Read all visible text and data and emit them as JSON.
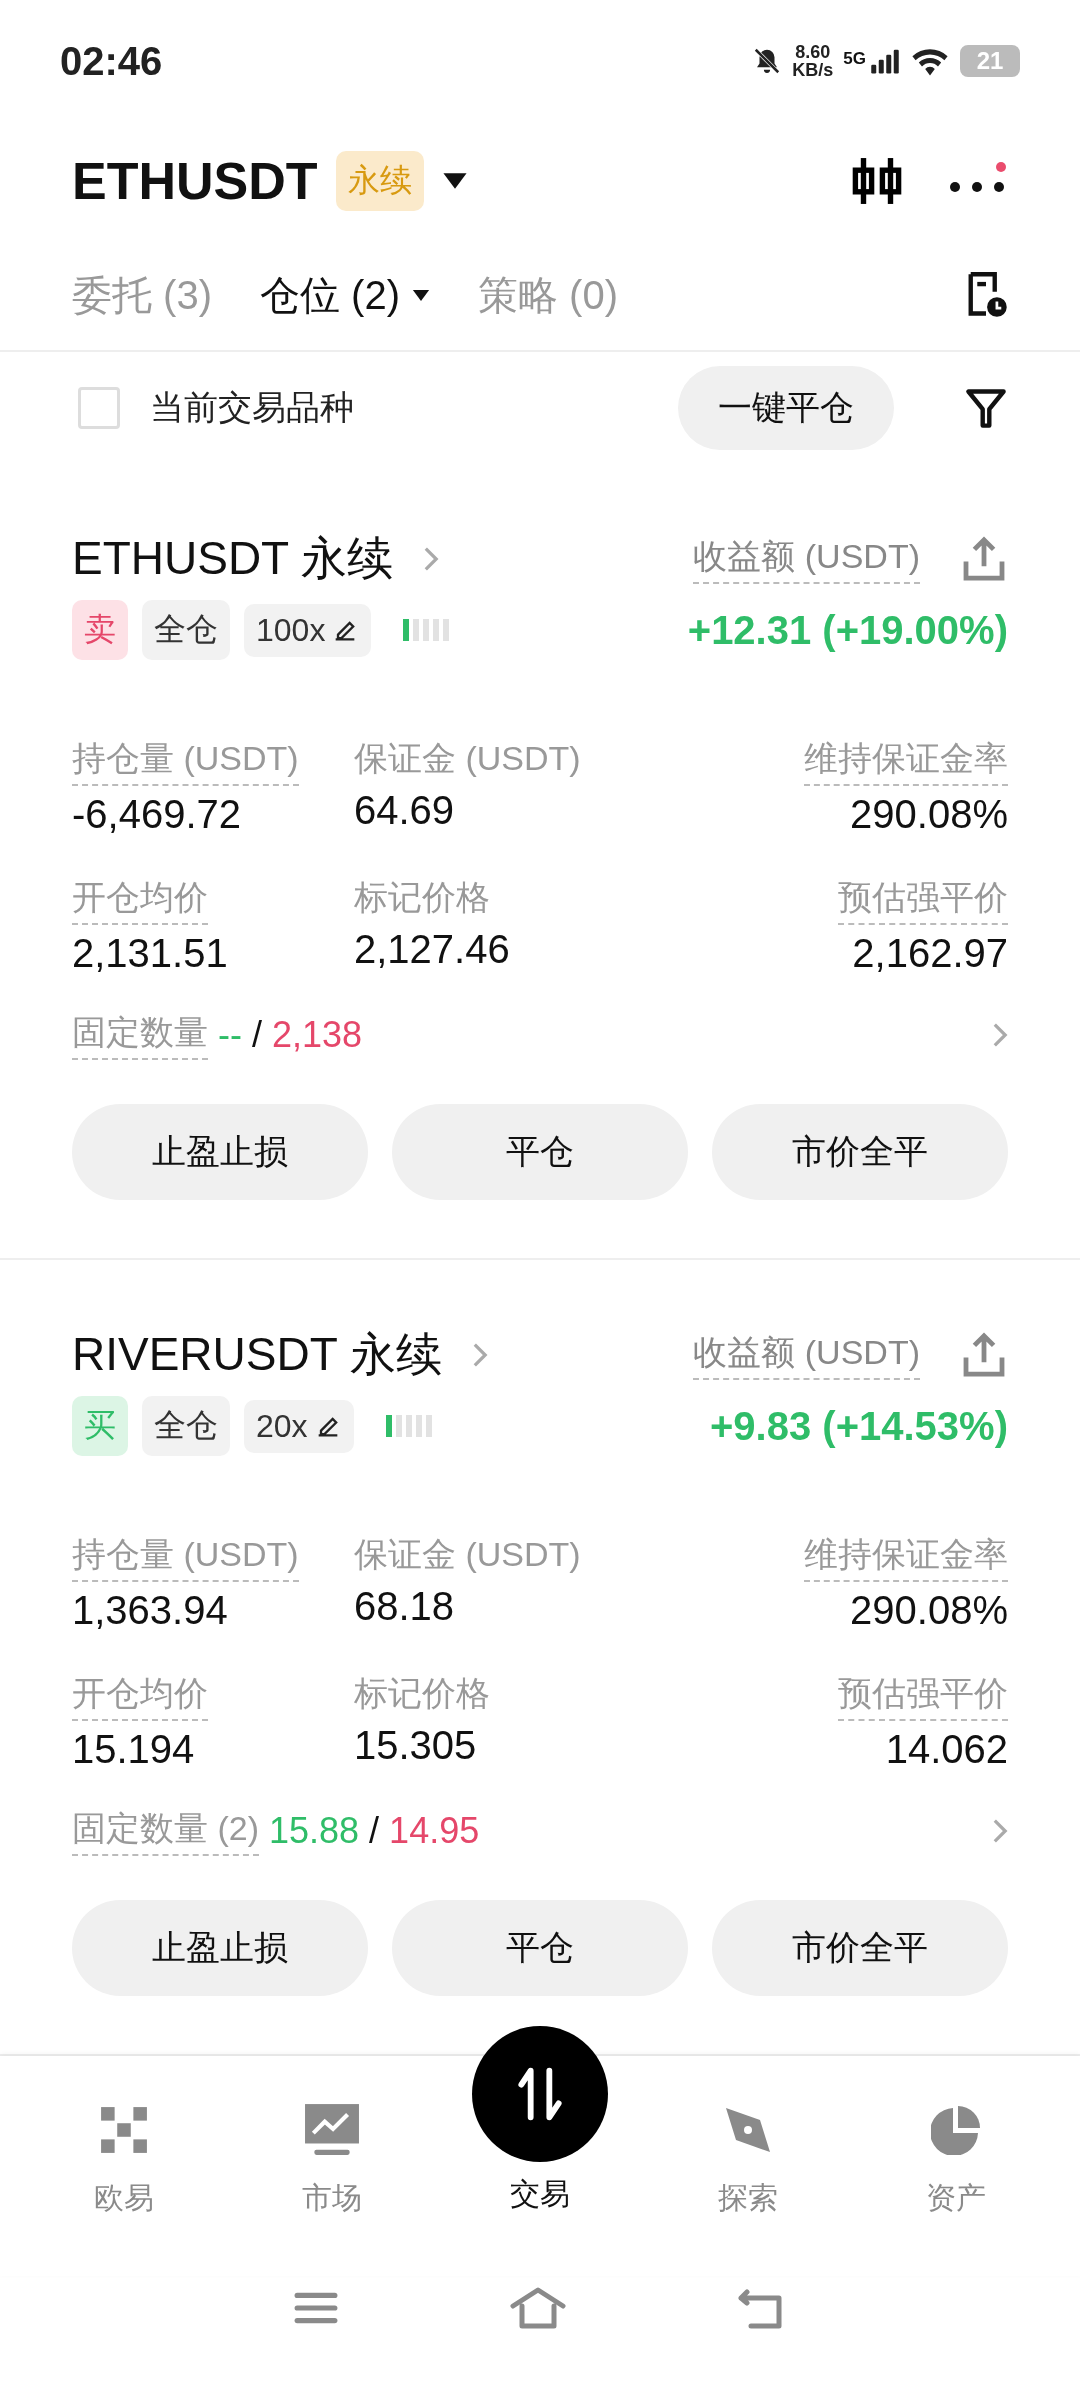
{
  "status_bar": {
    "time": "02:46",
    "net_speed": "8.60",
    "net_unit": "KB/s",
    "network": "5G",
    "battery": "21"
  },
  "header": {
    "symbol": "ETHUSDT",
    "badge": "永续",
    "notification": true
  },
  "tabs": [
    {
      "label": "委托 (3)",
      "selected": false,
      "dropdown": false
    },
    {
      "label": "仓位 (2)",
      "selected": true,
      "dropdown": true
    },
    {
      "label": "策略 (0)",
      "selected": false,
      "dropdown": false
    }
  ],
  "filter": {
    "checkbox_label": "当前交易品种",
    "checked": false,
    "close_all": "一键平仓"
  },
  "positions": [
    {
      "symbol": "ETHUSDT",
      "type": "永续",
      "pnl_label": "收益额 (USDT)",
      "side": {
        "label": "卖",
        "kind": "sell"
      },
      "margin_mode": "全仓",
      "leverage": "100x",
      "risk": {
        "level": 0.2
      },
      "pnl": "+12.31 (+19.00%)",
      "stats": [
        {
          "label": "持仓量 (USDT)",
          "value": "-6,469.72",
          "dashed": true
        },
        {
          "label": "保证金 (USDT)",
          "value": "64.69",
          "dashed": false
        },
        {
          "label": "维持保证金率",
          "value": "290.08%",
          "dashed": true
        },
        {
          "label": "开仓均价",
          "value": "2,131.51",
          "dashed": true
        },
        {
          "label": "标记价格",
          "value": "2,127.46",
          "dashed": false
        },
        {
          "label": "预估强平价",
          "value": "2,162.97",
          "dashed": true
        }
      ],
      "fixed": {
        "label": "固定数量",
        "take_profit": "--",
        "separator": "/",
        "stop_loss": "2,138"
      },
      "buttons": [
        "止盈止损",
        "平仓",
        "市价全平"
      ]
    },
    {
      "symbol": "RIVERUSDT",
      "type": "永续",
      "pnl_label": "收益额 (USDT)",
      "side": {
        "label": "买",
        "kind": "buy"
      },
      "margin_mode": "全仓",
      "leverage": "20x",
      "risk": {
        "level": 0.2
      },
      "pnl": "+9.83 (+14.53%)",
      "stats": [
        {
          "label": "持仓量 (USDT)",
          "value": "1,363.94",
          "dashed": true
        },
        {
          "label": "保证金 (USDT)",
          "value": "68.18",
          "dashed": false
        },
        {
          "label": "维持保证金率",
          "value": "290.08%",
          "dashed": true
        },
        {
          "label": "开仓均价",
          "value": "15.194",
          "dashed": true
        },
        {
          "label": "标记价格",
          "value": "15.305",
          "dashed": false
        },
        {
          "label": "预估强平价",
          "value": "14.062",
          "dashed": true
        }
      ],
      "fixed": {
        "label": "固定数量 (2)",
        "take_profit": "15.88",
        "separator": "/",
        "stop_loss": "14.95"
      },
      "buttons": [
        "止盈止损",
        "平仓",
        "市价全平"
      ]
    }
  ],
  "bottom_nav": [
    {
      "label": "欧易",
      "kind": "home",
      "selected": false
    },
    {
      "label": "市场",
      "kind": "market",
      "selected": false
    },
    {
      "label": "交易",
      "kind": "trade",
      "selected": true
    },
    {
      "label": "探索",
      "kind": "explore",
      "selected": false
    },
    {
      "label": "资产",
      "kind": "assets",
      "selected": false
    }
  ]
}
